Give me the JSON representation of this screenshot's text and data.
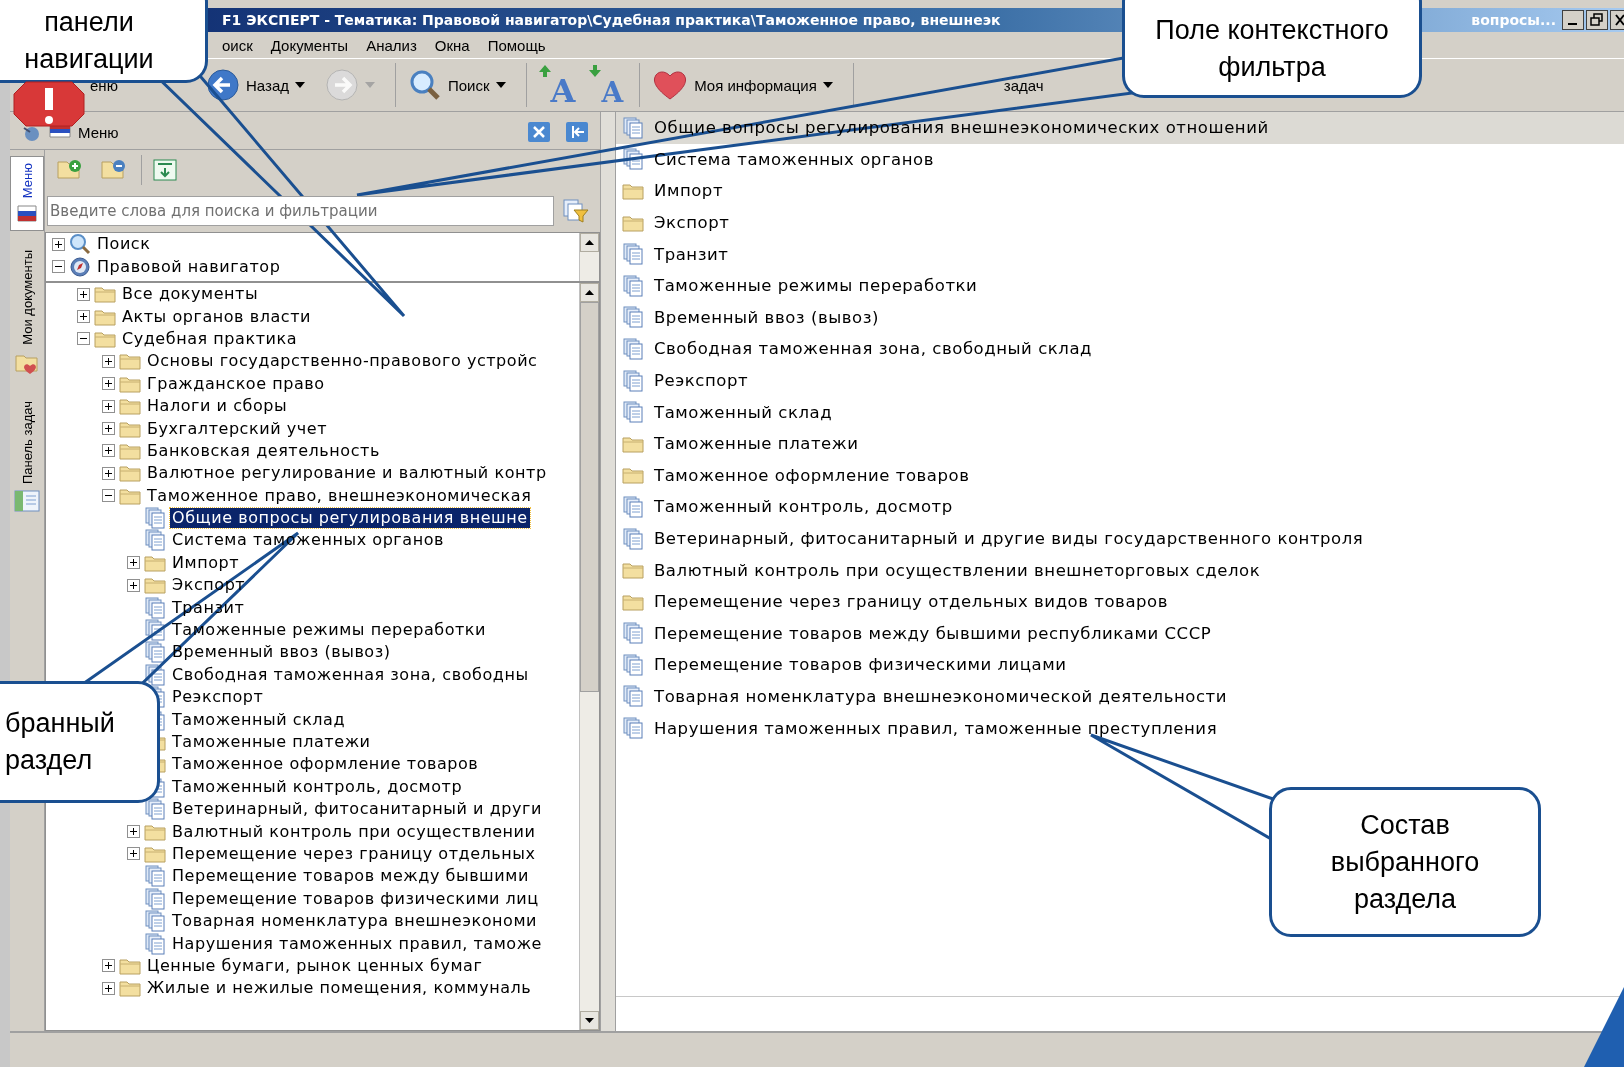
{
  "window": {
    "title": "F1 ЭКСПЕРТ - Тематика: Правовой навигатор\\Судебная практика\\Таможенное право, внешнеэк",
    "title_tail": "вопросы..."
  },
  "menu": [
    "оиск",
    "Документы",
    "Анализ",
    "Окна",
    "Помощь"
  ],
  "toolbar": [
    {
      "kind": "text",
      "label": "еню"
    },
    {
      "kind": "back",
      "label": "Назад"
    },
    {
      "kind": "forward",
      "disabled": true
    },
    {
      "kind": "search",
      "label": "Поиск"
    },
    {
      "kind": "font_up",
      "glyph": "A"
    },
    {
      "kind": "font_down",
      "glyph": "A"
    },
    {
      "kind": "favorites",
      "label": "Моя информация"
    },
    {
      "kind": "text",
      "label": "задач"
    }
  ],
  "panel": {
    "title": "Меню"
  },
  "side_tabs": [
    {
      "label": "Меню",
      "selected": true,
      "kind": "flag"
    },
    {
      "label": "Мои документы",
      "selected": false,
      "kind": "folder"
    },
    {
      "label": "Панель задач",
      "selected": false,
      "kind": "panel"
    }
  ],
  "filter": {
    "placeholder": "Введите слова для поиска и фильтрации"
  },
  "top_tree": [
    {
      "label": "Поиск",
      "kind": "search",
      "expanded": false
    },
    {
      "label": "Правовой навигатор",
      "kind": "navigator",
      "expanded": true
    }
  ],
  "tree": [
    {
      "label": "Все документы",
      "kind": "folder",
      "expanded": false
    },
    {
      "label": "Акты органов власти",
      "kind": "folder",
      "expanded": false
    },
    {
      "label": "Судебная практика",
      "kind": "folder",
      "expanded": true,
      "children": [
        {
          "label": "Основы государственно-правового устройс",
          "kind": "folder",
          "expanded": false
        },
        {
          "label": "Гражданское право",
          "kind": "folder",
          "expanded": false
        },
        {
          "label": "Налоги и сборы",
          "kind": "folder",
          "expanded": false
        },
        {
          "label": "Бухгалтерский учет",
          "kind": "folder",
          "expanded": false
        },
        {
          "label": "Банковская деятельность",
          "kind": "folder",
          "expanded": false
        },
        {
          "label": "Валютное регулирование и валютный контр",
          "kind": "folder",
          "expanded": false
        },
        {
          "label": "Таможенное право, внешнеэкономическая",
          "kind": "folder",
          "expanded": true,
          "children": [
            {
              "label": "Общие вопросы регулирования внешне",
              "kind": "doc",
              "selected": true
            },
            {
              "label": "Система таможенных органов",
              "kind": "doc",
              "selected": false
            },
            {
              "label": "Импорт",
              "kind": "folder",
              "expanded": false,
              "selected": false
            },
            {
              "label": "Экспорт",
              "kind": "folder",
              "expanded": false,
              "selected": false
            },
            {
              "label": "Транзит",
              "kind": "doc",
              "selected": false
            },
            {
              "label": "Таможенные режимы переработки",
              "kind": "doc",
              "selected": false
            },
            {
              "label": "Временный ввоз (вывоз)",
              "kind": "doc",
              "selected": false
            },
            {
              "label": "Свободная таможенная зона, свободны",
              "kind": "doc",
              "selected": false
            },
            {
              "label": "Реэкспорт",
              "kind": "doc",
              "selected": false
            },
            {
              "label": "Таможенный склад",
              "kind": "doc",
              "selected": false
            },
            {
              "label": "Таможенные платежи",
              "kind": "folder",
              "expanded": false,
              "selected": false
            },
            {
              "label": "Таможенное оформление товаров",
              "kind": "folder",
              "expanded": false,
              "selected": false
            },
            {
              "label": "Таможенный контроль, досмотр",
              "kind": "doc",
              "selected": false
            },
            {
              "label": "Ветеринарный, фитосанитарный и други",
              "kind": "doc",
              "selected": false
            },
            {
              "label": "Валютный контроль при осуществлении",
              "kind": "folder",
              "expanded": false,
              "selected": false
            },
            {
              "label": "Перемещение через границу отдельных",
              "kind": "folder",
              "expanded": false,
              "selected": false
            },
            {
              "label": "Перемещение товаров между бывшими",
              "kind": "doc",
              "selected": false
            },
            {
              "label": "Перемещение товаров физическими лиц",
              "kind": "doc",
              "selected": false
            },
            {
              "label": "Товарная номенклатура внешнеэкономи",
              "kind": "doc",
              "selected": false
            },
            {
              "label": "Нарушения таможенных правил, таможе",
              "kind": "doc",
              "selected": false
            }
          ]
        },
        {
          "label": "Ценные бумаги, рынок ценных бумаг",
          "kind": "folder",
          "expanded": false
        },
        {
          "label": "Жилые и нежилые помещения, коммуналь",
          "kind": "folder",
          "expanded": false
        }
      ]
    }
  ],
  "content_list": [
    {
      "label": "Общие вопросы регулирования внешнеэкономических отношений",
      "kind": "doc",
      "selected": true
    },
    {
      "label": "Система таможенных органов",
      "kind": "doc",
      "selected": false
    },
    {
      "label": "Импорт",
      "kind": "folder",
      "selected": false
    },
    {
      "label": "Экспорт",
      "kind": "folder",
      "selected": false
    },
    {
      "label": "Транзит",
      "kind": "doc",
      "selected": false
    },
    {
      "label": "Таможенные режимы переработки",
      "kind": "doc",
      "selected": false
    },
    {
      "label": "Временный ввоз (вывоз)",
      "kind": "doc",
      "selected": false
    },
    {
      "label": "Свободная таможенная зона, свободный склад",
      "kind": "doc",
      "selected": false
    },
    {
      "label": "Реэкспорт",
      "kind": "doc",
      "selected": false
    },
    {
      "label": "Таможенный склад",
      "kind": "doc",
      "selected": false
    },
    {
      "label": "Таможенные платежи",
      "kind": "folder",
      "selected": false
    },
    {
      "label": "Таможенное оформление товаров",
      "kind": "folder",
      "selected": false
    },
    {
      "label": "Таможенный контроль, досмотр",
      "kind": "doc",
      "selected": false
    },
    {
      "label": "Ветеринарный, фитосанитарный и другие виды государственного контроля",
      "kind": "doc",
      "selected": false
    },
    {
      "label": "Валютный контроль при осуществлении внешнеторговых сделок",
      "kind": "folder",
      "selected": false
    },
    {
      "label": "Перемещение через границу отдельных видов товаров",
      "kind": "folder",
      "selected": false
    },
    {
      "label": "Перемещение товаров между бывшими республиками СССР",
      "kind": "doc",
      "selected": false
    },
    {
      "label": "Перемещение товаров физическими лицами",
      "kind": "doc",
      "selected": false
    },
    {
      "label": "Товарная номенклатура внешнеэкономической деятельности",
      "kind": "doc",
      "selected": false
    },
    {
      "label": "Нарушения таможенных правил, таможенные преступления",
      "kind": "doc",
      "selected": false
    }
  ],
  "callouts": [
    {
      "kind": "nav",
      "text": "панели навигации"
    },
    {
      "kind": "filter",
      "text": "Поле контекстного фильтра"
    },
    {
      "kind": "selected",
      "text": "бранный раздел"
    },
    {
      "kind": "content",
      "text": "Состав выбранного раздела"
    }
  ]
}
